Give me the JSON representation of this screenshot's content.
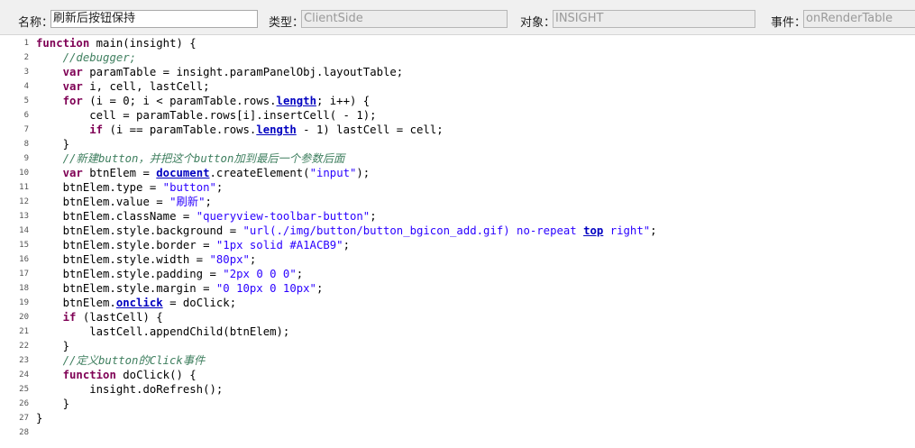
{
  "toolbar": {
    "name_label": "名称：",
    "name_value": "刷新后按钮保持",
    "type_label": "类型：",
    "type_value": "ClientSide",
    "object_label": "对象：",
    "object_value": "INSIGHT",
    "event_label": "事件：",
    "event_value": "onRenderTable"
  },
  "editor": {
    "lines": [
      {
        "n": "1",
        "t": [
          [
            "k",
            "function"
          ],
          [
            "p",
            " main(insight) {"
          ]
        ]
      },
      {
        "n": "2",
        "t": [
          [
            "p",
            "    "
          ],
          [
            "c",
            "//debugger;"
          ]
        ]
      },
      {
        "n": "3",
        "t": [
          [
            "p",
            "    "
          ],
          [
            "k",
            "var"
          ],
          [
            "p",
            " paramTable = insight.paramPanelObj.layoutTable;"
          ]
        ]
      },
      {
        "n": "4",
        "t": [
          [
            "p",
            "    "
          ],
          [
            "k",
            "var"
          ],
          [
            "p",
            " i, cell, lastCell;"
          ]
        ]
      },
      {
        "n": "5",
        "t": [
          [
            "p",
            "    "
          ],
          [
            "k",
            "for"
          ],
          [
            "p",
            " (i = 0; i < paramTable.rows."
          ],
          [
            "g",
            "length"
          ],
          [
            "p",
            "; i++) {"
          ]
        ]
      },
      {
        "n": "6",
        "t": [
          [
            "p",
            "        cell = paramTable.rows[i].insertCell( - 1);"
          ]
        ]
      },
      {
        "n": "7",
        "t": [
          [
            "p",
            "        "
          ],
          [
            "k",
            "if"
          ],
          [
            "p",
            " (i == paramTable.rows."
          ],
          [
            "g",
            "length"
          ],
          [
            "p",
            " - 1) lastCell = cell;"
          ]
        ]
      },
      {
        "n": "8",
        "t": [
          [
            "p",
            "    }"
          ]
        ]
      },
      {
        "n": "9",
        "t": [
          [
            "p",
            "    "
          ],
          [
            "c",
            "//新建button，并把这个button加到最后一个参数后面"
          ]
        ]
      },
      {
        "n": "10",
        "t": [
          [
            "p",
            "    "
          ],
          [
            "k",
            "var"
          ],
          [
            "p",
            " btnElem = "
          ],
          [
            "g",
            "document"
          ],
          [
            "p",
            ".createElement("
          ],
          [
            "s",
            "\"input\""
          ],
          [
            "p",
            ");"
          ]
        ]
      },
      {
        "n": "11",
        "t": [
          [
            "p",
            "    btnElem.type = "
          ],
          [
            "s",
            "\"button\""
          ],
          [
            "p",
            ";"
          ]
        ]
      },
      {
        "n": "12",
        "t": [
          [
            "p",
            "    btnElem.value = "
          ],
          [
            "s",
            "\"刷新\""
          ],
          [
            "p",
            ";"
          ]
        ]
      },
      {
        "n": "13",
        "t": [
          [
            "p",
            "    btnElem.className = "
          ],
          [
            "s",
            "\"queryview-toolbar-button\""
          ],
          [
            "p",
            ";"
          ]
        ]
      },
      {
        "n": "14",
        "t": [
          [
            "p",
            "    btnElem.style.background = "
          ],
          [
            "s",
            "\"url(./img/button/button_bgicon_add.gif) no-repeat "
          ],
          [
            "g",
            "top"
          ],
          [
            "s",
            " right\""
          ],
          [
            "p",
            ";"
          ]
        ]
      },
      {
        "n": "15",
        "t": [
          [
            "p",
            "    btnElem.style.border = "
          ],
          [
            "s",
            "\"1px solid #A1ACB9\""
          ],
          [
            "p",
            ";"
          ]
        ]
      },
      {
        "n": "16",
        "t": [
          [
            "p",
            "    btnElem.style.width = "
          ],
          [
            "s",
            "\"80px\""
          ],
          [
            "p",
            ";"
          ]
        ]
      },
      {
        "n": "17",
        "t": [
          [
            "p",
            "    btnElem.style.padding = "
          ],
          [
            "s",
            "\"2px 0 0 0\""
          ],
          [
            "p",
            ";"
          ]
        ]
      },
      {
        "n": "18",
        "t": [
          [
            "p",
            "    btnElem.style.margin = "
          ],
          [
            "s",
            "\"0 10px 0 10px\""
          ],
          [
            "p",
            ";"
          ]
        ]
      },
      {
        "n": "19",
        "t": [
          [
            "p",
            "    btnElem."
          ],
          [
            "g",
            "onclick"
          ],
          [
            "p",
            " = doClick;"
          ]
        ]
      },
      {
        "n": "20",
        "t": [
          [
            "p",
            "    "
          ],
          [
            "k",
            "if"
          ],
          [
            "p",
            " (lastCell) {"
          ]
        ]
      },
      {
        "n": "21",
        "t": [
          [
            "p",
            "        lastCell.appendChild(btnElem);"
          ]
        ]
      },
      {
        "n": "22",
        "t": [
          [
            "p",
            "    }"
          ]
        ]
      },
      {
        "n": "23",
        "t": [
          [
            "p",
            "    "
          ],
          [
            "c",
            "//定义button的Click事件"
          ]
        ]
      },
      {
        "n": "24",
        "t": [
          [
            "p",
            "    "
          ],
          [
            "k",
            "function"
          ],
          [
            "p",
            " doClick() {"
          ]
        ]
      },
      {
        "n": "25",
        "t": [
          [
            "p",
            "        insight.doRefresh();"
          ]
        ]
      },
      {
        "n": "26",
        "t": [
          [
            "p",
            "    }"
          ]
        ]
      },
      {
        "n": "27",
        "t": [
          [
            "p",
            "}"
          ]
        ]
      },
      {
        "n": "28",
        "t": []
      }
    ]
  },
  "colors": {
    "keyword": "#7f0055",
    "comment": "#3f7f5f",
    "string": "#2a00ff",
    "global": "#0000c0"
  }
}
